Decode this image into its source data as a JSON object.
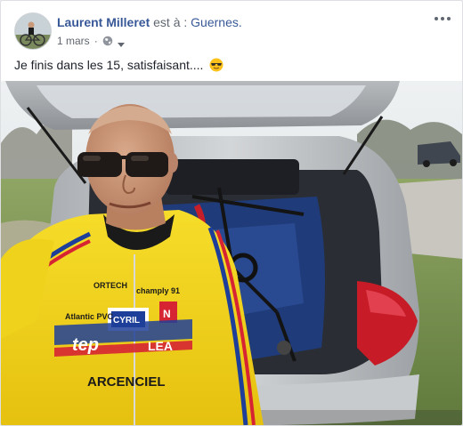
{
  "post": {
    "author": "Laurent Milleret",
    "location_prefix": "est à :",
    "location": "Guernes.",
    "date": "1 mars",
    "separator": "·",
    "privacy_icon": "globe-icon",
    "audience_menu_icon": "caret-down-icon",
    "options_icon": "more-horizontal-icon",
    "text": "Je finis dans les 15, satisfaisant....",
    "emoji": "cool-sunglasses-emoji"
  },
  "photo": {
    "jersey_texts": {
      "brand": "ORTECH",
      "sponsor1": "champly 91",
      "sponsor2": "CYRIL",
      "sponsor3": "Atlantic PVC",
      "sponsor4": "ARCENCIEL",
      "sponsor5": "tep",
      "sponsor6": "LEA",
      "sponsor7": "N"
    }
  },
  "colors": {
    "link": "#385898",
    "meta": "#616770",
    "text": "#1d2129",
    "jersey_yellow": "#f2d41a",
    "car_silver": "#c6c9cc",
    "tail_light": "#d21f2a"
  }
}
